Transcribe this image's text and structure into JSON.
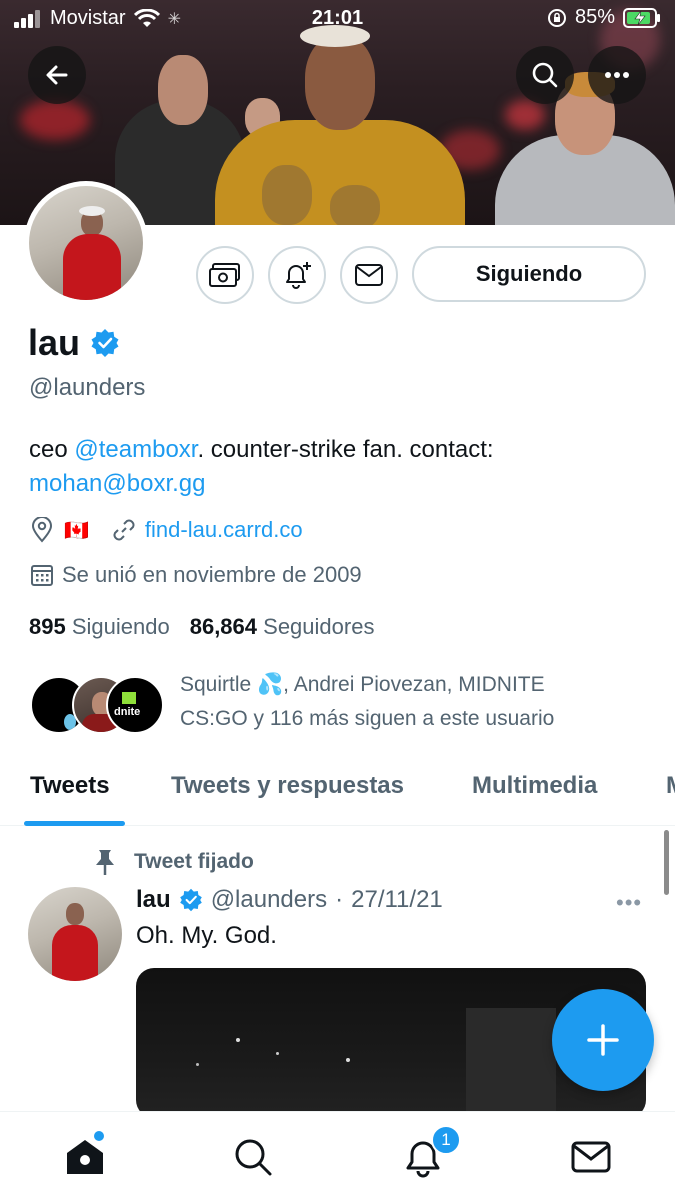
{
  "status_bar": {
    "carrier": "Movistar",
    "time": "21:01",
    "battery": "85%"
  },
  "profile": {
    "name": "lau",
    "handle": "@launders",
    "bio_prefix": "ceo ",
    "bio_mention": "@teamboxr",
    "bio_middle": ". counter-strike fan. contact:",
    "bio_email": "mohan@boxr.gg",
    "location_flag": "🇨🇦",
    "website": "find-lau.carrd.co",
    "joined": "Se unió en noviembre de 2009",
    "following_count": "895",
    "following_label": "Siguiendo",
    "followers_count": "86,864",
    "followers_label": "Seguidores",
    "follow_button": "Siguiendo",
    "followers_you_know_line1": "Squirtle 💦, Andrei Piovezan, MIDNITE",
    "followers_you_know_line2": "CS:GO y 116 más siguen a este usuario",
    "midnite_logo_text": "dnite"
  },
  "tabs": [
    {
      "label": "Tweets",
      "active": true
    },
    {
      "label": "Tweets y respuestas",
      "active": false
    },
    {
      "label": "Multimedia",
      "active": false
    },
    {
      "label": "M",
      "active": false
    }
  ],
  "pinned_tweet": {
    "pinned_label": "Tweet fijado",
    "author_name": "lau",
    "author_handle": "@launders",
    "separator": "·",
    "date": "27/11/21",
    "text": "Oh. My. God.",
    "more": "•••"
  },
  "bottom_nav": {
    "notifications_badge": "1"
  },
  "colors": {
    "accent": "#1d9bf0",
    "text_primary": "#0f1419",
    "text_secondary": "#536471",
    "border": "#cfd9de"
  },
  "icons": [
    "back-arrow-icon",
    "search-icon",
    "more-icon",
    "tip-jar-icon",
    "bell-plus-icon",
    "mail-icon",
    "verified-badge-icon",
    "location-pin-icon",
    "link-icon",
    "calendar-icon",
    "pin-icon",
    "plus-icon",
    "home-icon",
    "bell-icon"
  ]
}
